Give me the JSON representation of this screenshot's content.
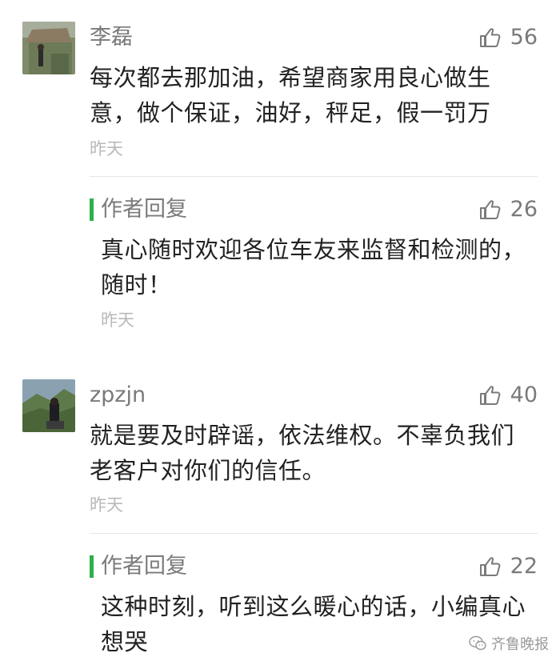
{
  "comments": [
    {
      "user": "李磊",
      "likes": "56",
      "text": "每次都去那加油，希望商家用良心做生意，做个保证，油好，秤足，假一罚万",
      "time": "昨天",
      "reply": {
        "title": "作者回复",
        "likes": "26",
        "text": "真心随时欢迎各位车友来监督和检测的，随时！",
        "time": "昨天"
      }
    },
    {
      "user": "zpzjn",
      "likes": "40",
      "text": "就是要及时辟谣，依法维权。不辜负我们老客户对你们的信任。",
      "time": "昨天",
      "reply": {
        "title": "作者回复",
        "likes": "22",
        "text": "这种时刻，听到这么暖心的话，小编真心想哭"
      }
    }
  ],
  "watermark": "齐鲁晚报",
  "icons": {
    "like": "thumbs-up-icon",
    "watermark": "wechat-icon"
  },
  "colors": {
    "reply_bar": "#2bb14a",
    "muted_text": "#7a7a7a",
    "body_text": "#222222",
    "time_text": "#b9b9b9"
  }
}
